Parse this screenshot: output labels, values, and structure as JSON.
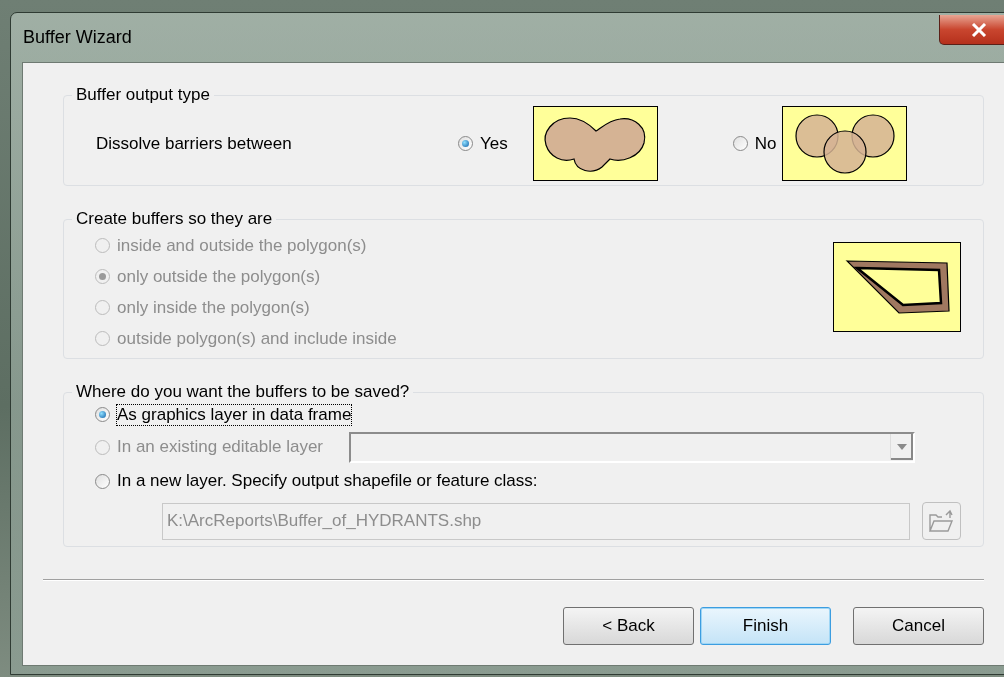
{
  "window": {
    "title": "Buffer Wizard"
  },
  "output_type": {
    "title": "Buffer output type",
    "label": "Dissolve barriers between",
    "options": [
      {
        "label": "Yes",
        "selected": true,
        "kind": "dissolved"
      },
      {
        "label": "No",
        "selected": false,
        "kind": "overlapping"
      }
    ]
  },
  "create": {
    "title": "Create buffers so they are",
    "options": [
      {
        "label": "inside and outside the polygon(s)",
        "selected": false,
        "disabled": true
      },
      {
        "label": "only outside the polygon(s)",
        "selected": true,
        "disabled": true
      },
      {
        "label": "only inside the polygon(s)",
        "selected": false,
        "disabled": true
      },
      {
        "label": "outside polygon(s) and include inside",
        "selected": false,
        "disabled": true
      }
    ]
  },
  "save": {
    "title": "Where do you want the buffers to be saved?",
    "options": [
      {
        "label": "As graphics layer in data frame",
        "selected": true,
        "disabled": false,
        "kind": "plain",
        "focused": true
      },
      {
        "label": "In an existing editable layer",
        "selected": false,
        "disabled": true,
        "kind": "dropdown",
        "focused": false
      },
      {
        "label": "In a new layer.  Specify output shapefile or feature class:",
        "selected": false,
        "disabled": false,
        "kind": "file",
        "focused": false
      }
    ],
    "path": {
      "value": "K:\\ArcReports\\Buffer_of_HYDRANTS.shp",
      "disabled": true
    }
  },
  "buttons": [
    {
      "label": "< Back",
      "default": false
    },
    {
      "label": "Finish",
      "default": true
    },
    {
      "label": "Cancel",
      "default": false
    }
  ]
}
